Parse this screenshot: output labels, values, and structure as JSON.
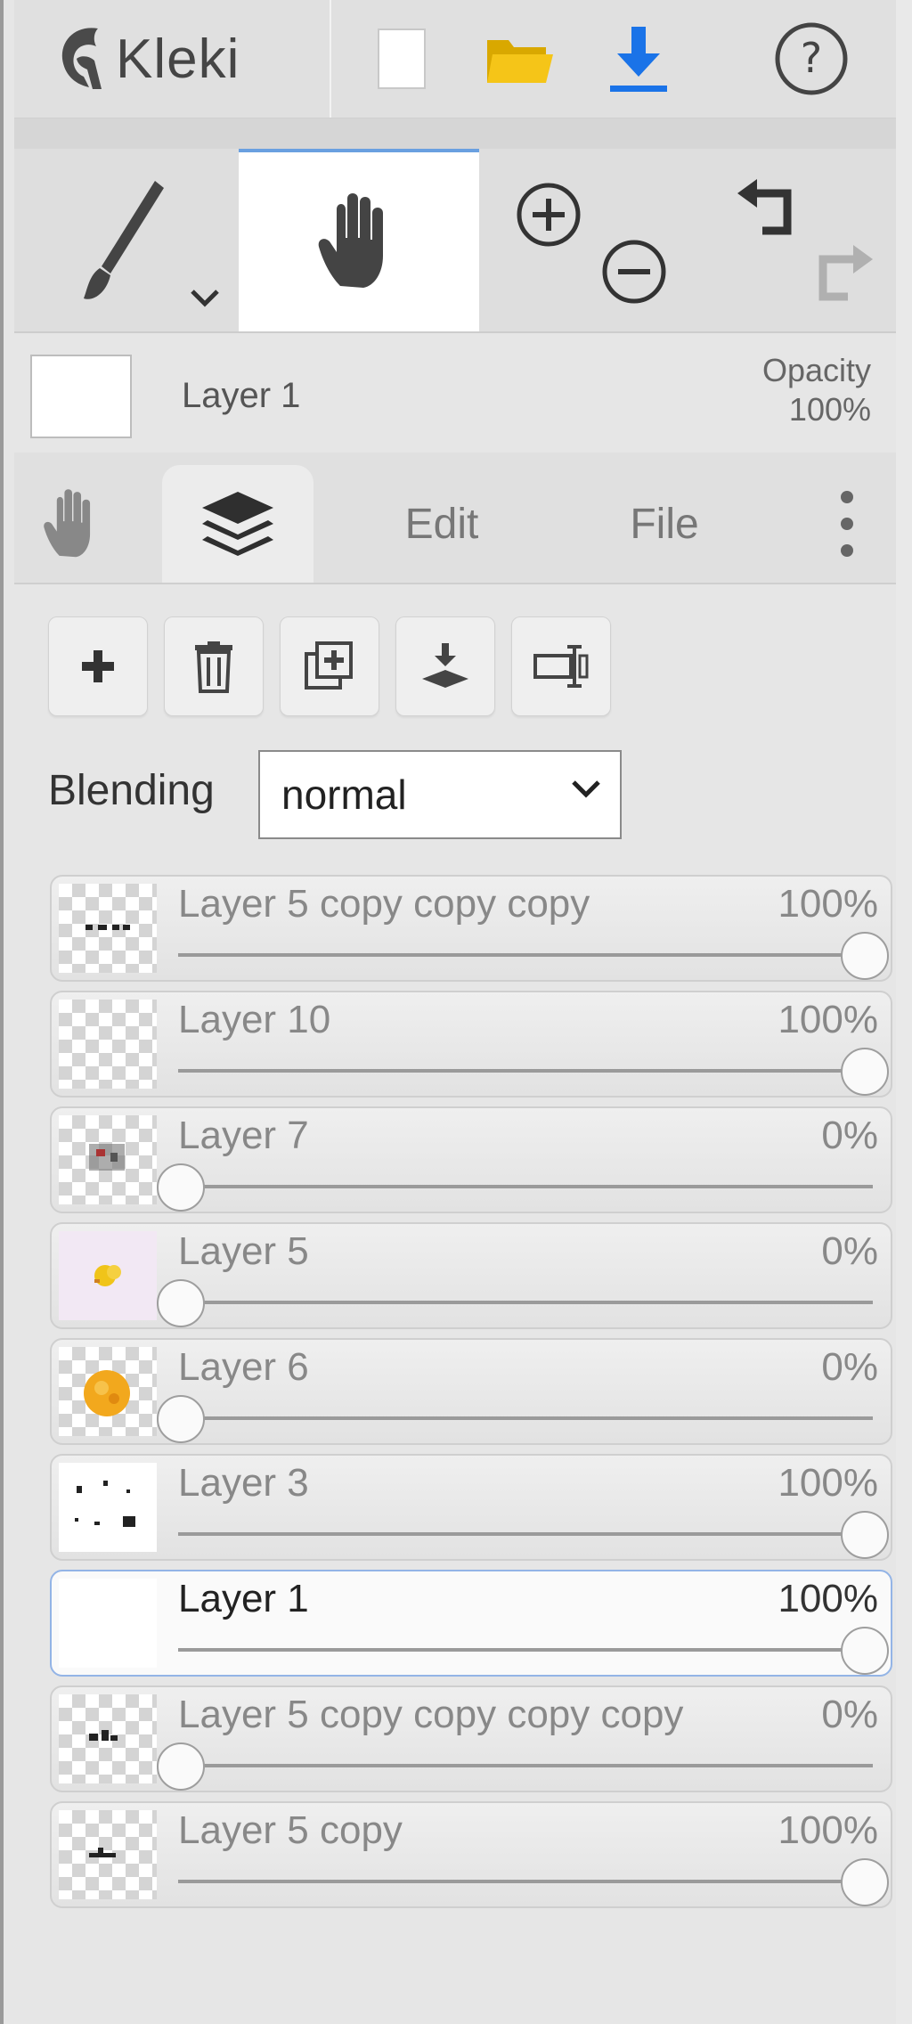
{
  "app": {
    "name": "Kleki"
  },
  "topbar": {
    "new_icon": "new-file-icon",
    "open_icon": "folder-open-icon",
    "save_icon": "download-icon",
    "help_icon": "help-icon",
    "save_color": "#1a73e8",
    "folder_color": "#f5c518"
  },
  "tools": {
    "brush_icon": "brush-icon",
    "hand_icon": "hand-icon",
    "zoom_in_icon": "zoom-in-icon",
    "zoom_out_icon": "zoom-out-icon",
    "undo_icon": "undo-icon",
    "redo_icon": "redo-icon",
    "active": "hand"
  },
  "current_layer": {
    "name": "Layer 1",
    "opacity_label": "Opacity",
    "opacity_value": "100%"
  },
  "tabs": [
    {
      "id": "hand",
      "icon": "hand-icon"
    },
    {
      "id": "layers",
      "icon": "layers-icon",
      "active": true
    },
    {
      "id": "edit",
      "label": "Edit"
    },
    {
      "id": "file",
      "label": "File"
    },
    {
      "id": "more",
      "icon": "more-vertical-icon"
    }
  ],
  "layer_actions": [
    {
      "icon": "add-layer-icon"
    },
    {
      "icon": "delete-layer-icon"
    },
    {
      "icon": "duplicate-layer-icon"
    },
    {
      "icon": "merge-down-icon"
    },
    {
      "icon": "rename-layer-icon"
    }
  ],
  "blending": {
    "label": "Blending",
    "value": "normal"
  },
  "layers": [
    {
      "name": "Layer 5 copy copy copy",
      "opacity": "100%",
      "fraction": 1.0
    },
    {
      "name": "Layer 10",
      "opacity": "100%",
      "fraction": 1.0
    },
    {
      "name": "Layer 7",
      "opacity": "0%",
      "fraction": 0.0
    },
    {
      "name": "Layer 5",
      "opacity": "0%",
      "fraction": 0.0
    },
    {
      "name": "Layer 6",
      "opacity": "0%",
      "fraction": 0.0
    },
    {
      "name": "Layer 3",
      "opacity": "100%",
      "fraction": 1.0
    },
    {
      "name": "Layer 1",
      "opacity": "100%",
      "fraction": 1.0,
      "selected": true
    },
    {
      "name": "Layer 5 copy copy copy copy",
      "opacity": "0%",
      "fraction": 0.0
    },
    {
      "name": "Layer 5 copy",
      "opacity": "100%",
      "fraction": 1.0
    }
  ]
}
